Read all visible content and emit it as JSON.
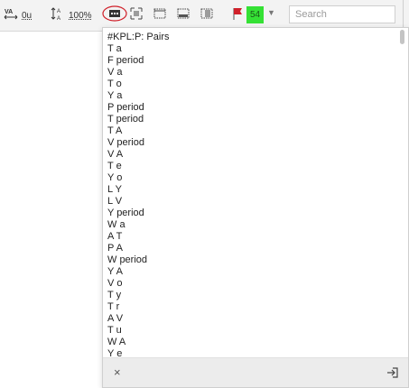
{
  "toolbar": {
    "tracking_value": "0u",
    "scale_value": "100%",
    "flag_color": "#d0202a",
    "badge_count": "54",
    "badge_color": "#35e135",
    "search_placeholder": "Search",
    "icons": [
      "kerning-icon",
      "vertical-scale-icon",
      "pairs-dropdown-icon",
      "fit-frame-icon",
      "frame-icon",
      "baseline-frame-icon",
      "columns-icon",
      "flag-icon",
      "chevron-down-icon"
    ]
  },
  "popup": {
    "items": [
      "#KPL:P: Pairs",
      "T a",
      "F period",
      "V a",
      "T o",
      "Y a",
      "P period",
      "T period",
      "T A",
      "V period",
      "V A",
      "T e",
      "Y o",
      "L Y",
      "L V",
      "Y period",
      "W a",
      "A T",
      "P A",
      "W period",
      "Y A",
      "V o",
      "T y",
      "T r",
      "A V",
      "T u",
      "W A",
      "Y e"
    ],
    "close_label": "×"
  }
}
